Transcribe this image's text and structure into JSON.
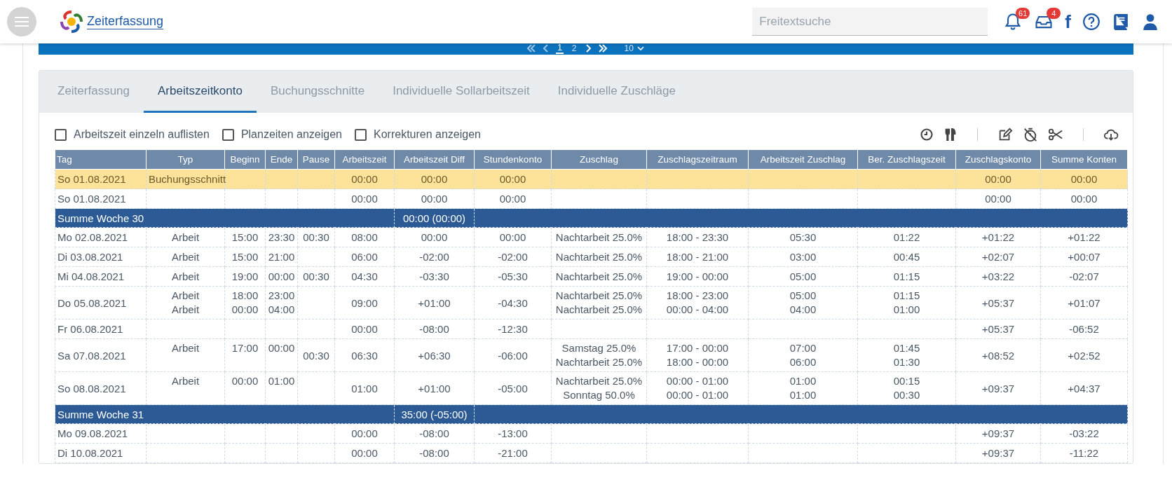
{
  "header": {
    "app_title": "Zeiterfassung",
    "search": {
      "placeholder": "Freitextsuche"
    },
    "notifications_badge": "61",
    "inbox_badge": "4",
    "social_glyph": "f"
  },
  "pagination": {
    "pages": [
      {
        "label": "1",
        "selected": true
      },
      {
        "label": "2",
        "selected": false
      }
    ],
    "page_size": "10"
  },
  "tabs": [
    {
      "label": "Zeiterfassung",
      "selected": false
    },
    {
      "label": "Arbeitszeitkonto",
      "selected": true
    },
    {
      "label": "Buchungsschnitte",
      "selected": false
    },
    {
      "label": "Individuelle Sollarbeitszeit",
      "selected": false
    },
    {
      "label": "Individuelle Zuschläge",
      "selected": false
    }
  ],
  "options": [
    {
      "label": "Arbeitszeit einzeln auflisten",
      "checked": false
    },
    {
      "label": "Planzeiten anzeigen",
      "checked": false
    },
    {
      "label": "Korrekturen anzeigen",
      "checked": false
    }
  ],
  "table": {
    "columns": [
      "Tag",
      "Typ",
      "Beginn",
      "Ende",
      "Pause",
      "Arbeitszeit",
      "Arbeitszeit Diff",
      "Stundenkonto",
      "Zuschlag",
      "Zuschlagszeitraum",
      "Arbeitszeit Zuschlag",
      "Ber. Zuschlagszeit",
      "Zuschlagskonto",
      "Summe Konten"
    ],
    "rows": [
      {
        "kind": "highlight",
        "cells": [
          "So 01.08.2021",
          "Buchungsschnitt",
          null,
          null,
          null,
          "00:00",
          "00:00",
          "00:00",
          null,
          null,
          null,
          null,
          "00:00",
          "00:00"
        ]
      },
      {
        "kind": "day",
        "cells": [
          "So 01.08.2021",
          null,
          null,
          null,
          null,
          "00:00",
          "00:00",
          "00:00",
          null,
          null,
          null,
          null,
          "00:00",
          "00:00"
        ]
      },
      {
        "kind": "week",
        "label": "Summe Woche 30",
        "total": "00:00 (00:00)"
      },
      {
        "kind": "day",
        "cells": [
          "Mo 02.08.2021",
          "Arbeit",
          "15:00",
          "23:30",
          "00:30",
          "08:00",
          "00:00",
          "00:00",
          "Nachtarbeit 25.0%",
          "18:00 - 23:30",
          "05:30",
          "01:22",
          "+01:22",
          "+01:22"
        ]
      },
      {
        "kind": "day",
        "cells": [
          "Di 03.08.2021",
          "Arbeit",
          "15:00",
          "21:00",
          null,
          "06:00",
          "-02:00",
          "-02:00",
          "Nachtarbeit 25.0%",
          "18:00 - 21:00",
          "03:00",
          "00:45",
          "+02:07",
          "+00:07"
        ]
      },
      {
        "kind": "day",
        "cells": [
          "Mi 04.08.2021",
          "Arbeit",
          "19:00",
          "00:00",
          "00:30",
          "04:30",
          "-03:30",
          "-05:30",
          "Nachtarbeit 25.0%",
          "19:00 - 00:00",
          "05:00",
          "01:15",
          "+03:22",
          "-02:07"
        ]
      },
      {
        "kind": "day",
        "cells": [
          "Do 05.08.2021",
          [
            "Arbeit",
            "Arbeit"
          ],
          [
            "18:00",
            "00:00"
          ],
          [
            "23:00",
            "04:00"
          ],
          null,
          "09:00",
          "+01:00",
          "-04:30",
          [
            "Nachtarbeit 25.0%",
            "Nachtarbeit 25.0%"
          ],
          [
            "18:00 - 23:00",
            "00:00 - 04:00"
          ],
          [
            "05:00",
            "04:00"
          ],
          [
            "01:15",
            "01:00"
          ],
          "+05:37",
          "+01:07"
        ]
      },
      {
        "kind": "day",
        "cells": [
          "Fr 06.08.2021",
          null,
          null,
          null,
          null,
          "00:00",
          "-08:00",
          "-12:30",
          null,
          null,
          null,
          null,
          "+05:37",
          "-06:52"
        ]
      },
      {
        "kind": "day",
        "cells": [
          "Sa 07.08.2021",
          [
            "Arbeit"
          ],
          [
            "17:00"
          ],
          [
            "00:00"
          ],
          "00:30",
          "06:30",
          "+06:30",
          "-06:00",
          [
            "Samstag 25.0%",
            "Nachtarbeit 25.0%"
          ],
          [
            "17:00 - 00:00",
            "18:00 - 00:00"
          ],
          [
            "07:00",
            "06:00"
          ],
          [
            "01:45",
            "01:30"
          ],
          "+08:52",
          "+02:52"
        ]
      },
      {
        "kind": "day",
        "cells": [
          "So 08.08.2021",
          [
            "Arbeit"
          ],
          [
            "00:00"
          ],
          [
            "01:00"
          ],
          null,
          "01:00",
          "+01:00",
          "-05:00",
          [
            "Nachtarbeit 25.0%",
            "Sonntag 50.0%"
          ],
          [
            "00:00 - 01:00",
            "00:00 - 01:00"
          ],
          [
            "01:00",
            "01:00"
          ],
          [
            "00:15",
            "00:30"
          ],
          "+09:37",
          "+04:37"
        ]
      },
      {
        "kind": "week",
        "label": "Summe Woche 31",
        "total": "35:00 (-05:00)"
      },
      {
        "kind": "day",
        "cells": [
          "Mo 09.08.2021",
          null,
          null,
          null,
          null,
          "00:00",
          "-08:00",
          "-13:00",
          null,
          null,
          null,
          null,
          "+09:37",
          "-03:22"
        ]
      },
      {
        "kind": "day",
        "cells": [
          "Di 10.08.2021",
          null,
          null,
          null,
          null,
          "00:00",
          "-08:00",
          "-21:00",
          null,
          null,
          null,
          null,
          "+09:37",
          "-11:22"
        ]
      }
    ]
  }
}
